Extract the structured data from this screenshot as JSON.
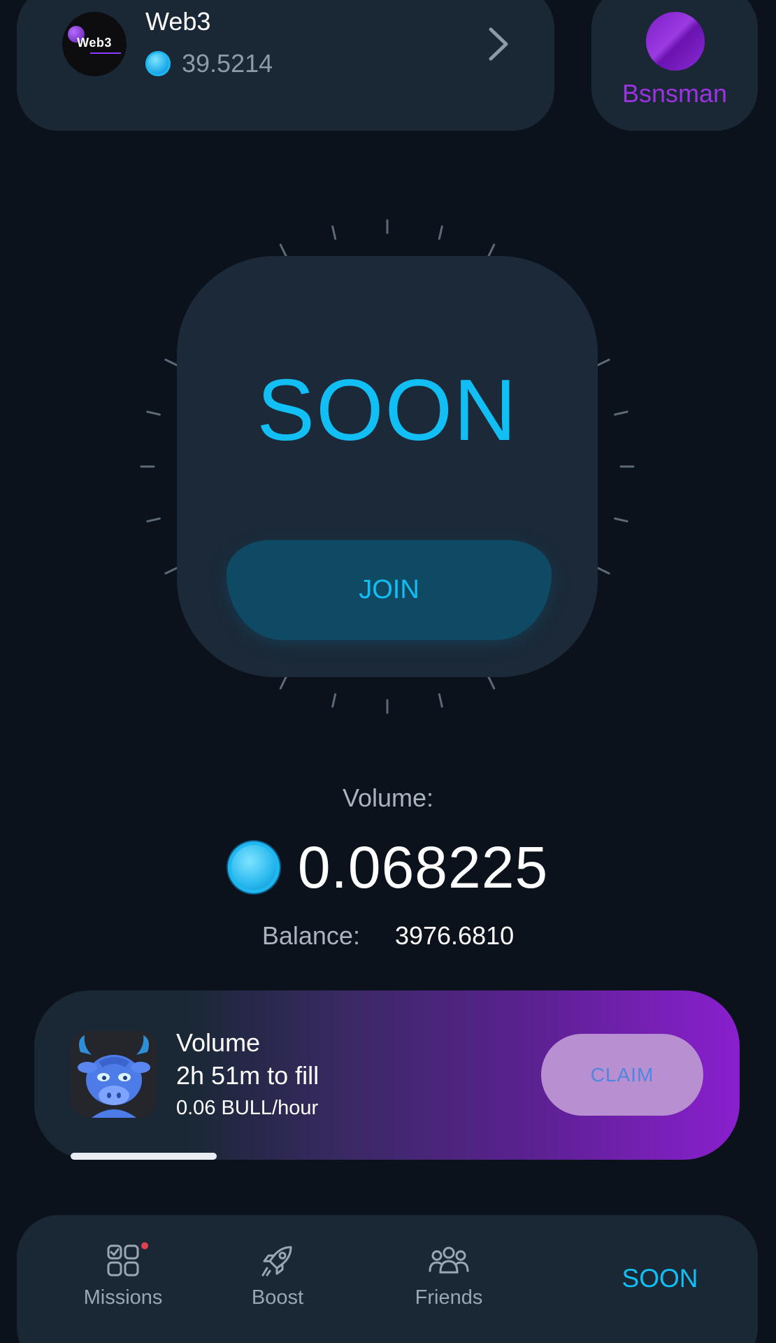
{
  "header": {
    "logo_text": "Web3",
    "title": "Web3",
    "coin_balance": "39.5214"
  },
  "profile": {
    "username": "Bsnsman"
  },
  "main": {
    "status_label": "SOON",
    "join_label": "JOIN"
  },
  "volume": {
    "label": "Volume:",
    "value": "0.068225",
    "balance_label": "Balance:",
    "balance_value": "3976.6810"
  },
  "mining": {
    "title": "Volume",
    "time_to_fill": "2h 51m to fill",
    "rate": "0.06 BULL/hour",
    "claim_label": "CLAIM",
    "progress": 0.23
  },
  "nav": {
    "items": [
      {
        "label": "Missions",
        "icon": "missions-grid-icon"
      },
      {
        "label": "Boost",
        "icon": "rocket-icon"
      },
      {
        "label": "Friends",
        "icon": "friends-icon"
      }
    ],
    "soon_label": "SOON"
  },
  "colors": {
    "background": "#0b121b",
    "card": "#1a2836",
    "accent_cyan": "#12bff5",
    "accent_purple": "#9b34e0",
    "notification_dot": "#e0414f"
  }
}
